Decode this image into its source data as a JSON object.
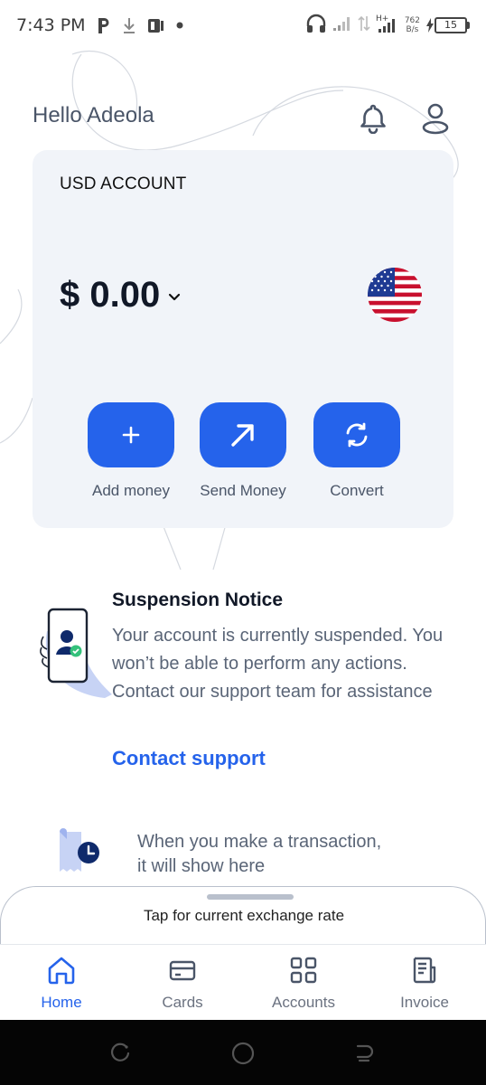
{
  "status_bar": {
    "time": "7:43 PM",
    "icons": [
      "parking-icon",
      "download-icon",
      "app-notification-icon",
      "dot-icon"
    ],
    "right_icons": [
      "headphones-icon",
      "signal-icon",
      "data-transfer-icon",
      "signal-h-plus-icon"
    ],
    "network_speed_value": "762",
    "network_speed_unit": "B/s",
    "battery_level": "15"
  },
  "header": {
    "greeting": "Hello Adeola",
    "bell_icon": "bell-icon",
    "profile_icon": "profile-icon"
  },
  "account": {
    "title": "USD ACCOUNT",
    "balance": "$ 0.00",
    "currency_flag": "us-flag-icon",
    "actions": [
      {
        "label": "Add money",
        "icon": "plus-icon"
      },
      {
        "label": "Send Money",
        "icon": "arrow-up-right-icon"
      },
      {
        "label": "Convert",
        "icon": "convert-icon"
      }
    ]
  },
  "notice": {
    "title": "Suspension Notice",
    "body": "Your account is currently suspended. You won’t be able to perform any actions. Contact our support team for assistance",
    "link": "Contact support"
  },
  "transactions": {
    "empty_line1": "When you make a transaction,",
    "empty_line2": "it will show here"
  },
  "exchange_sheet": {
    "label": "Tap for current exchange rate"
  },
  "bottom_nav": {
    "items": [
      {
        "label": "Home",
        "icon": "home-icon",
        "active": true
      },
      {
        "label": "Cards",
        "icon": "card-icon",
        "active": false
      },
      {
        "label": "Accounts",
        "icon": "accounts-grid-icon",
        "active": false
      },
      {
        "label": "Invoice",
        "icon": "invoice-icon",
        "active": false
      }
    ]
  },
  "colors": {
    "primary": "#2563eb",
    "card_background": "#f1f4f9",
    "text_dark": "#111827",
    "text_muted": "#5a6577"
  }
}
